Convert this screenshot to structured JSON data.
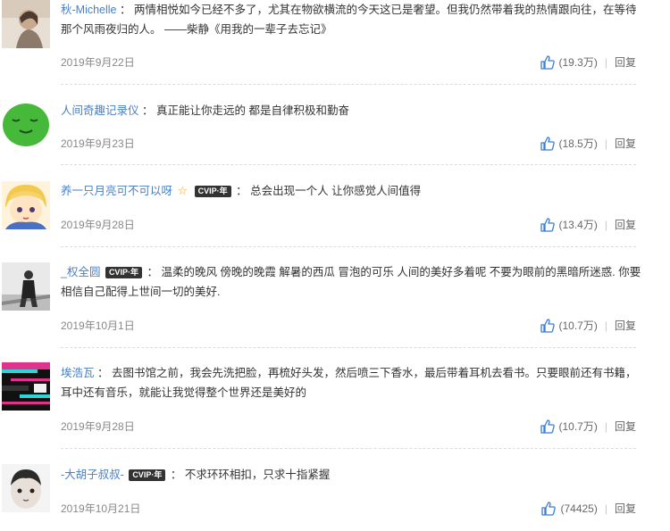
{
  "comments": [
    {
      "user": "秋-Michelle",
      "vip": "",
      "star": "",
      "sep": "：",
      "text": "两情相悦如今已经不多了，尤其在物欲横流的今天这已是奢望。但我仍然带着我的热情跟向往，在等待那个风雨夜归的人。 ——柴静《用我的一辈子去忘记》",
      "date": "2019年9月22日",
      "likes": "(19.3万)",
      "reply": "回复"
    },
    {
      "user": "人间奇趣记录仪",
      "vip": "",
      "star": "",
      "sep": "：",
      "text": "真正能让你走远的 都是自律积极和勤奋",
      "date": "2019年9月23日",
      "likes": "(18.5万)",
      "reply": "回复"
    },
    {
      "user": "养一只月亮可不可以呀",
      "vip": "CVIP·年",
      "star": "☆",
      "sep": "：",
      "text": "总会出现一个人 让你感觉人间值得",
      "date": "2019年9月28日",
      "likes": "(13.4万)",
      "reply": "回复"
    },
    {
      "user": "_权全圆",
      "vip": "CVIP·年",
      "star": "",
      "sep": "：",
      "text": "温柔的晚风 傍晚的晚霞 解暑的西瓜 冒泡的可乐 人间的美好多着呢 不要为眼前的黑暗所迷惑. 你要相信自己配得上世间一切的美好.",
      "date": "2019年10月1日",
      "likes": "(10.7万)",
      "reply": "回复"
    },
    {
      "user": "埃浩瓦",
      "vip": "",
      "star": "",
      "sep": "：",
      "text": "去图书馆之前，我会先洗把脸，再梳好头发，然后喷三下香水，最后带着耳机去看书。只要眼前还有书籍，耳中还有音乐，就能让我觉得整个世界还是美好的",
      "date": "2019年9月28日",
      "likes": "(10.7万)",
      "reply": "回复"
    },
    {
      "user": "-大胡子叔叔-",
      "vip": "CVIP·年",
      "star": "",
      "sep": "：",
      "text": "不求环环相扣，只求十指紧握",
      "date": "2019年10月21日",
      "likes": "(74425)",
      "reply": "回复"
    }
  ],
  "icons": {
    "like": "thumbs-up-icon"
  },
  "colors": {
    "link": "#4a7fc4",
    "meta": "#888888",
    "text": "#333333",
    "vip_bg": "#333333",
    "star": "#f5a623"
  }
}
